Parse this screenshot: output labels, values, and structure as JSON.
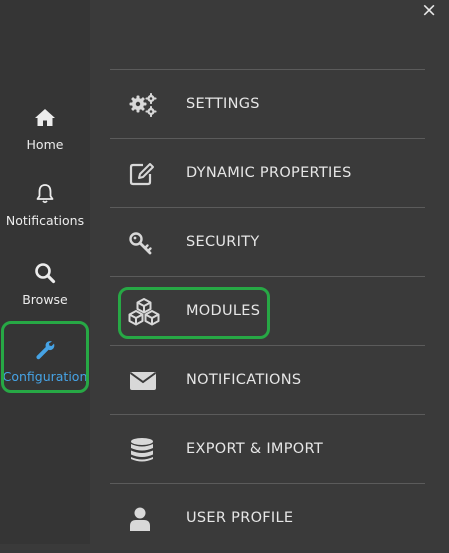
{
  "sidebar": {
    "items": [
      {
        "label": "Home",
        "icon": "home-icon"
      },
      {
        "label": "Notifications",
        "icon": "bell-icon"
      },
      {
        "label": "Browse",
        "icon": "search-icon"
      },
      {
        "label": "Configuration",
        "icon": "wrench-icon",
        "active": true
      }
    ],
    "active_color": "#46a3e5",
    "highlight_color": "#27a845"
  },
  "panel": {
    "close_label": "×",
    "items": [
      {
        "label": "SETTINGS",
        "icon": "gears-icon"
      },
      {
        "label": "DYNAMIC PROPERTIES",
        "icon": "edit-icon"
      },
      {
        "label": "SECURITY",
        "icon": "key-icon"
      },
      {
        "label": "MODULES",
        "icon": "cubes-icon"
      },
      {
        "label": "NOTIFICATIONS",
        "icon": "envelope-icon"
      },
      {
        "label": "EXPORT & IMPORT",
        "icon": "database-icon"
      },
      {
        "label": "USER PROFILE",
        "icon": "user-icon"
      }
    ]
  }
}
